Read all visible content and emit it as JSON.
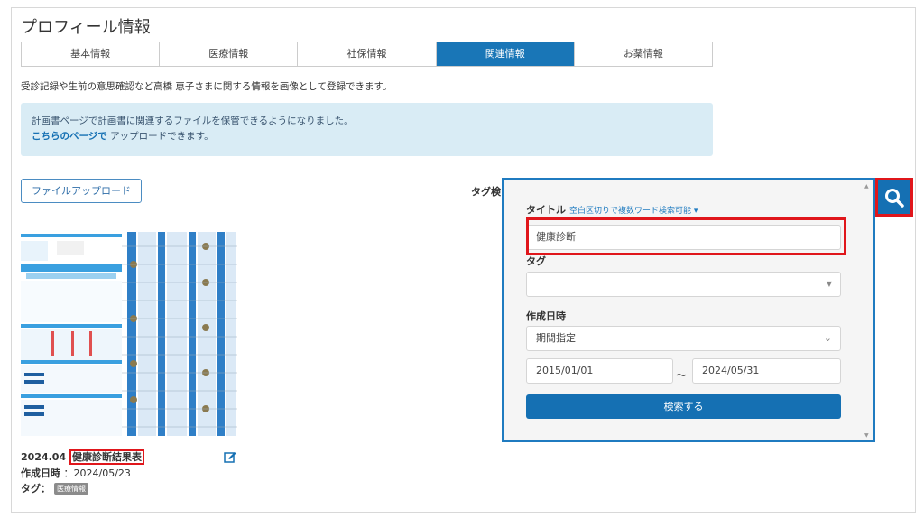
{
  "page": {
    "title": "プロフィール情報"
  },
  "tabs": [
    {
      "label": "基本情報",
      "active": false
    },
    {
      "label": "医療情報",
      "active": false
    },
    {
      "label": "社保情報",
      "active": false
    },
    {
      "label": "関連情報",
      "active": true
    },
    {
      "label": "お薬情報",
      "active": false
    }
  ],
  "description": "受診記録や生前の意思確認など高橋 恵子さまに関する情報を画像として登録できます。",
  "info": {
    "line1": "計画書ページで計画書に関連するファイルを保管できるようになりました。",
    "link": "こちらのページで",
    "line2_rest": " アップロードできます。"
  },
  "upload_button": "ファイルアップロード",
  "tag_search_label": "タグ検",
  "document": {
    "title_prefix": "2024.04",
    "title_highlight": "健康診断結果表",
    "created_label": "作成日時",
    "created_value": "：2024/05/23",
    "tags_label": "タグ：",
    "tag": "医療情報"
  },
  "search": {
    "title_label": "タイトル",
    "title_hint": "空白区切りで複数ワード検索可能 ▾",
    "title_value": "健康診断",
    "tag_label": "タグ",
    "date_label": "作成日時",
    "period_select": "期間指定",
    "date_from": "2015/01/01",
    "date_sep": "〜",
    "date_to": "2024/05/31",
    "submit": "検索する"
  },
  "icons": {
    "search_toggle": "magnifier-icon",
    "edit": "edit-icon"
  },
  "colors": {
    "accent": "#1570b3",
    "highlight": "#e0161b",
    "info_bg": "#d9ecf5"
  }
}
